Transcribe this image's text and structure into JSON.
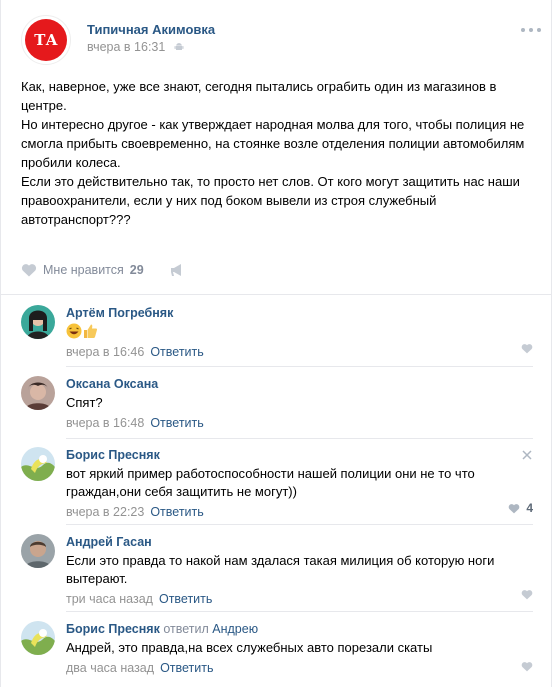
{
  "post": {
    "author": "Типичная Акимовка",
    "logo_text": "ТА",
    "time": "вчера в 16:31",
    "device_icon": "android-icon",
    "menu_icon": "more-icon",
    "paragraphs": [
      "Как, наверное, уже все знают, сегодня пытались ограбить один из магазинов в центре.",
      "Но интересно другое - как утверждает народная молва для того, чтобы полиция не смогла прибыть своевременно, на стоянке возле отделения полиции автомобилям пробили колеса.",
      "Если это действительно так, то просто нет слов. От кого могут защитить нас наши правоохранители, если у них под боком вывели из строя служебный автотранспорт???"
    ],
    "like_label": "Мне нравится",
    "like_count": "29",
    "share_icon": "megaphone-icon"
  },
  "comments": [
    {
      "author": "Артём Погребняк",
      "text": "",
      "emoji": [
        "grinning-face-emoji",
        "thumbs-up-emoji"
      ],
      "time": "вчера в 16:46",
      "reply_label": "Ответить",
      "like_count": ""
    },
    {
      "author": "Оксана Оксана",
      "text": "Спят?",
      "time": "вчера в 16:48",
      "reply_label": "Ответить",
      "like_count": ""
    },
    {
      "author": "Борис Пресняк",
      "text": "вот яркий пример работоспособности нашей полиции они не то что граждан,они себя защитить не могут))",
      "time": "вчера в 22:23",
      "reply_label": "Ответить",
      "like_count": "4"
    },
    {
      "author": "Андрей Гасан",
      "text": "Если это правда то накой нам здалася такая милиция об которую ноги вытерают.",
      "time": "три часа назад",
      "reply_label": "Ответить",
      "like_count": ""
    },
    {
      "author": "Борис Пресняк",
      "reply_to_label": "ответил",
      "reply_to_name": "Андрею",
      "text": "Андрей, это правда,на всех служебных авто порезали скаты",
      "time": "два часа назад",
      "reply_label": "Ответить",
      "like_count": ""
    }
  ],
  "colors": {
    "link": "#2a5885",
    "meta": "#939393",
    "icon": "#aeb7c2",
    "logo_red": "#e5191c"
  }
}
